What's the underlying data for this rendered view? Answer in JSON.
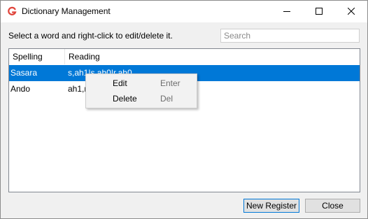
{
  "window": {
    "title": "Dictionary Management",
    "app_icon": "app-logo-icon",
    "controls": {
      "minimize": "minimize-icon",
      "maximize": "maximize-icon",
      "close": "close-icon"
    }
  },
  "toolbar": {
    "instruction": "Select a word and right-click to edit/delete it.",
    "search_placeholder": "Search",
    "search_value": ""
  },
  "table": {
    "columns": [
      "Spelling",
      "Reading"
    ],
    "rows": [
      {
        "spelling": "Sasara",
        "reading": "s,ah1|s,ah0|r,ah0",
        "selected": true
      },
      {
        "spelling": "Ando",
        "reading": "ah1,n"
      }
    ]
  },
  "context_menu": {
    "items": [
      {
        "label": "Edit",
        "shortcut": "Enter"
      },
      {
        "label": "Delete",
        "shortcut": "Del"
      }
    ]
  },
  "footer": {
    "register_label": "New Register",
    "close_label": "Close"
  },
  "colors": {
    "selection": "#0078d7",
    "accent_icon": "#e0443a"
  }
}
